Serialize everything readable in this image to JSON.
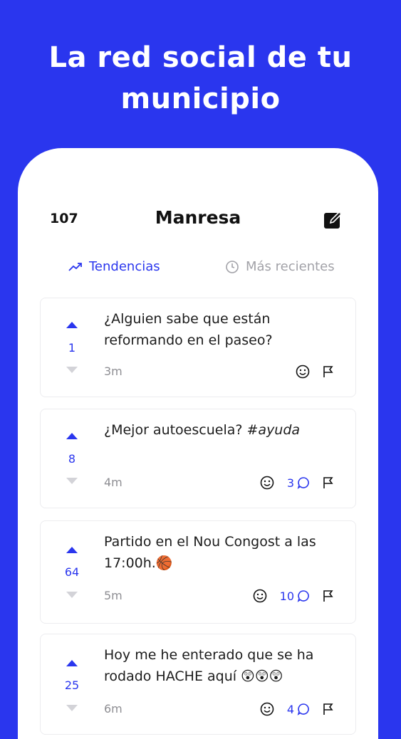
{
  "hero": {
    "line1": "La red social de tu",
    "line2": "municipio"
  },
  "header": {
    "count": "107",
    "title": "Manresa"
  },
  "tabs": [
    {
      "label": "Tendencias",
      "active": true,
      "icon": "trending-icon"
    },
    {
      "label": "Más recientes",
      "active": false,
      "icon": "clock-icon"
    }
  ],
  "posts": [
    {
      "text": "¿Alguien sabe que están reformando en el paseo?",
      "votes": "1",
      "time": "3m",
      "comments": ""
    },
    {
      "text": "¿Mejor autoescuela? #ayuda",
      "votes": "8",
      "time": "4m",
      "comments": "3"
    },
    {
      "text": "Partido en el Nou Congost a las 17:00h.🏀",
      "votes": "64",
      "time": "5m",
      "comments": "10"
    },
    {
      "text": "Hoy me he enterado que se ha rodado HACHE aquí 😲😲😲",
      "votes": "25",
      "time": "6m",
      "comments": "4"
    }
  ],
  "colors": {
    "accent": "#2a36ee",
    "background": "#ffffff",
    "muted": "#8e8e93"
  }
}
